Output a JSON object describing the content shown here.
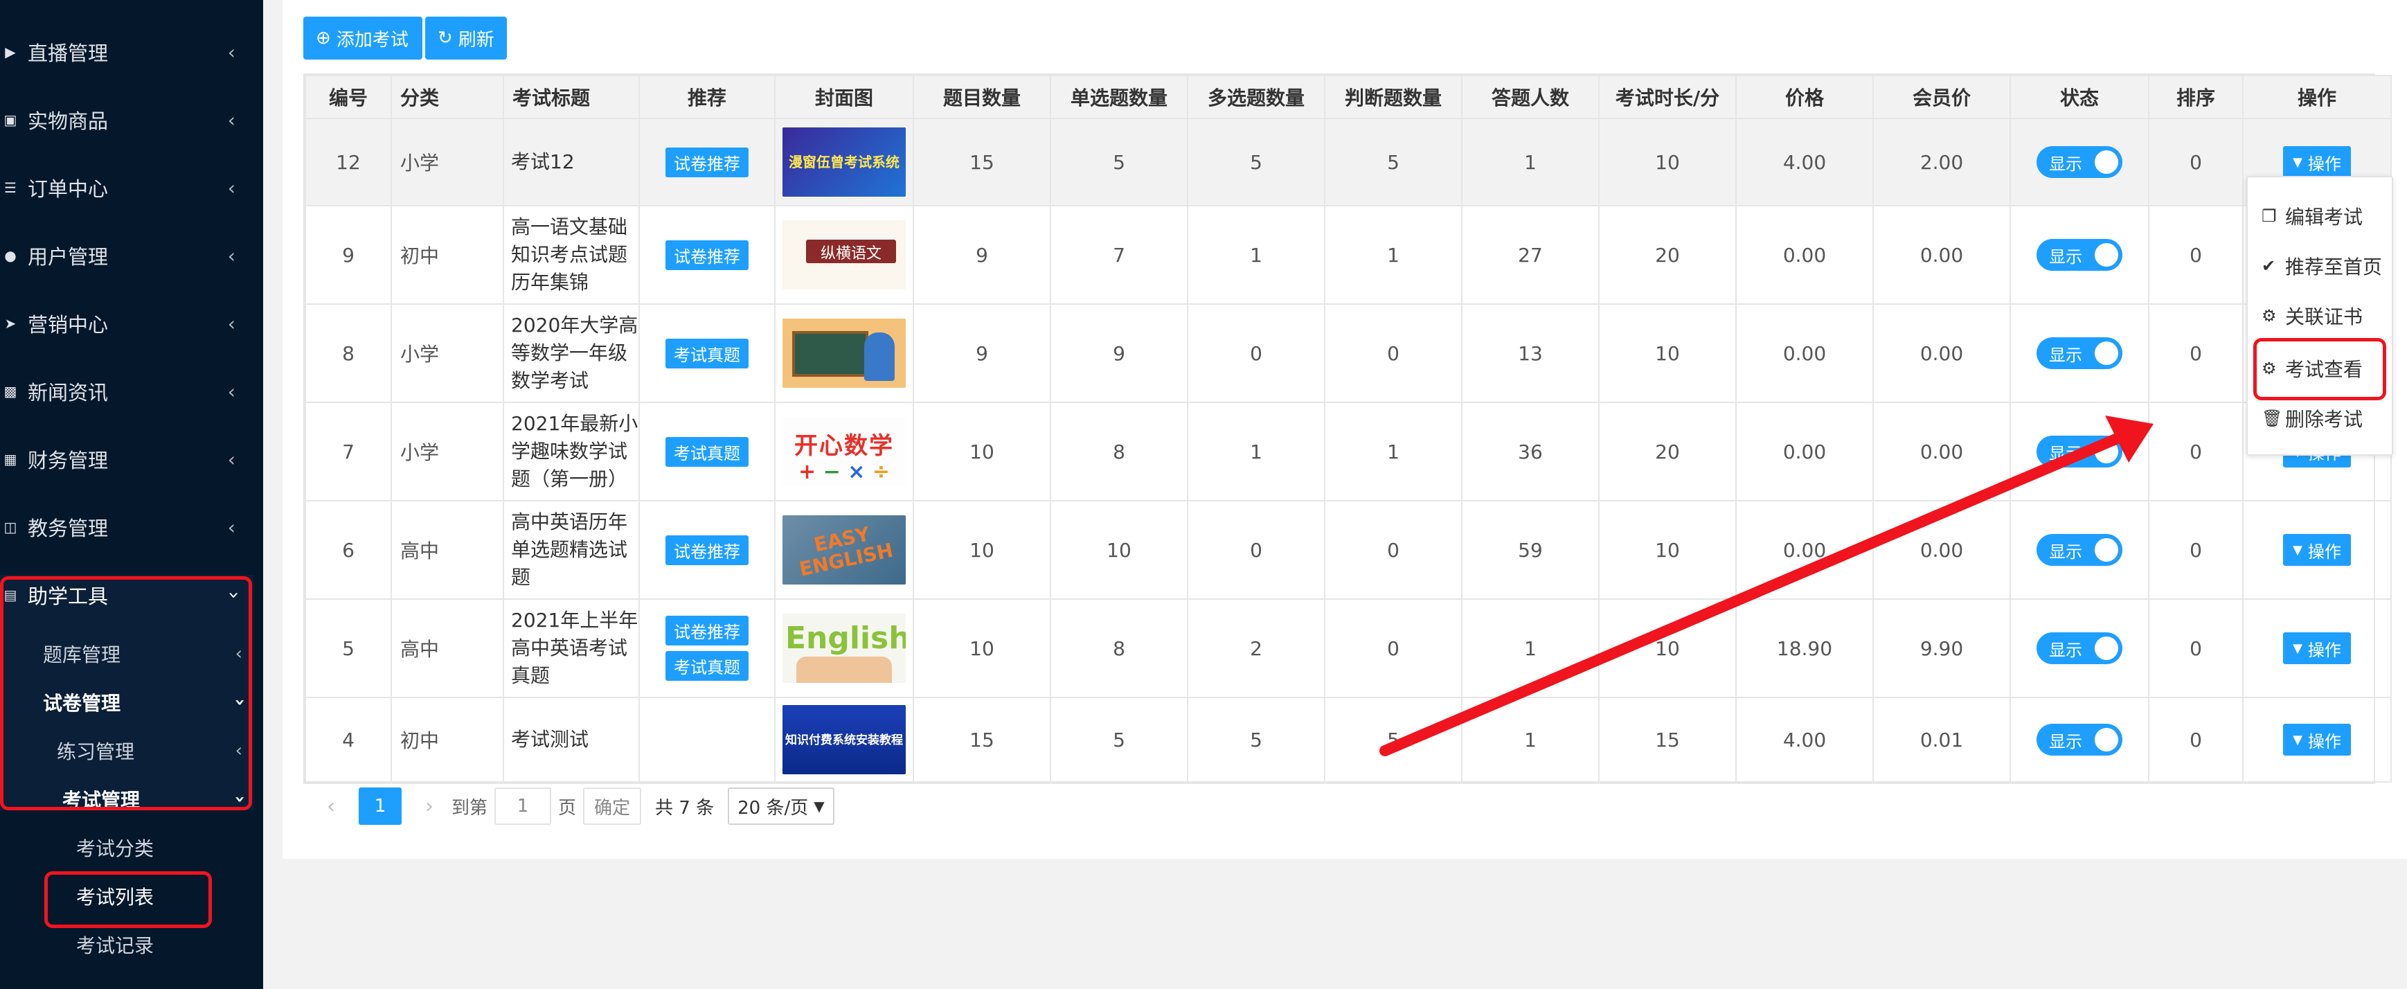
{
  "sidebar": {
    "items": [
      {
        "label": "直播管理",
        "icon": "video-icon"
      },
      {
        "label": "实物商品",
        "icon": "cart-icon"
      },
      {
        "label": "订单中心",
        "icon": "list-icon"
      },
      {
        "label": "用户管理",
        "icon": "user-icon"
      },
      {
        "label": "营销中心",
        "icon": "send-icon"
      },
      {
        "label": "新闻资讯",
        "icon": "image-icon"
      },
      {
        "label": "财务管理",
        "icon": "chart-icon"
      },
      {
        "label": "教务管理",
        "icon": "book-icon"
      }
    ],
    "active_group": "助学工具",
    "sub": {
      "question_bank": "题库管理",
      "paper_manage": "试卷管理",
      "practice_manage": "练习管理",
      "exam_manage": "考试管理",
      "exam_category": "考试分类",
      "exam_list": "考试列表",
      "exam_record": "考试记录"
    }
  },
  "toolbar": {
    "add_label": "添加考试",
    "refresh_label": "刷新"
  },
  "table": {
    "headers": [
      "编号",
      "分类",
      "考试标题",
      "推荐",
      "封面图",
      "题目数量",
      "单选题数量",
      "多选题数量",
      "判断题数量",
      "答题人数",
      "考试时长/分",
      "价格",
      "会员价",
      "状态",
      "排序",
      "操作"
    ],
    "rows": [
      {
        "id": "12",
        "category": "小学",
        "title": "考试12",
        "tags": [
          "试卷推荐"
        ],
        "cover_text": "漫窗伍曾考试系统",
        "q": "15",
        "single": "5",
        "multi": "5",
        "judge": "5",
        "people": "1",
        "duration": "10",
        "price": "4.00",
        "vip": "2.00",
        "status": "显示",
        "sort": "0",
        "op": "操作"
      },
      {
        "id": "9",
        "category": "初中",
        "title": "高一语文基础知识考点试题历年集锦",
        "tags": [
          "试卷推荐"
        ],
        "cover_text": "纵横语文",
        "q": "9",
        "single": "7",
        "multi": "1",
        "judge": "1",
        "people": "27",
        "duration": "20",
        "price": "0.00",
        "vip": "0.00",
        "status": "显示",
        "sort": "0",
        "op": "操作"
      },
      {
        "id": "8",
        "category": "小学",
        "title": "2020年大学高等数学一年级数学考试",
        "tags": [
          "考试真题"
        ],
        "cover_text": "",
        "q": "9",
        "single": "9",
        "multi": "0",
        "judge": "0",
        "people": "13",
        "duration": "10",
        "price": "0.00",
        "vip": "0.00",
        "status": "显示",
        "sort": "0",
        "op": "操作"
      },
      {
        "id": "7",
        "category": "小学",
        "title": "2021年最新小学趣味数学试题（第一册）",
        "tags": [
          "考试真题"
        ],
        "cover_text": "开心数学",
        "q": "10",
        "single": "8",
        "multi": "1",
        "judge": "1",
        "people": "36",
        "duration": "20",
        "price": "0.00",
        "vip": "0.00",
        "status": "显示",
        "sort": "0",
        "op": "操作"
      },
      {
        "id": "6",
        "category": "高中",
        "title": "高中英语历年单选题精选试题",
        "tags": [
          "试卷推荐"
        ],
        "cover_text": "EASY ENGLISH",
        "q": "10",
        "single": "10",
        "multi": "0",
        "judge": "0",
        "people": "59",
        "duration": "10",
        "price": "0.00",
        "vip": "0.00",
        "status": "显示",
        "sort": "0",
        "op": "操作"
      },
      {
        "id": "5",
        "category": "高中",
        "title": "2021年上半年高中英语考试真题",
        "tags": [
          "试卷推荐",
          "考试真题"
        ],
        "cover_text": "English",
        "q": "10",
        "single": "8",
        "multi": "2",
        "judge": "0",
        "people": "1",
        "duration": "10",
        "price": "18.90",
        "vip": "9.90",
        "status": "显示",
        "sort": "0",
        "op": "操作"
      },
      {
        "id": "4",
        "category": "初中",
        "title": "考试测试",
        "tags": [],
        "cover_text": "知识付费系统安装教程",
        "q": "15",
        "single": "5",
        "multi": "5",
        "judge": "5",
        "people": "1",
        "duration": "15",
        "price": "4.00",
        "vip": "0.01",
        "status": "显示",
        "sort": "0",
        "op": "操作"
      }
    ]
  },
  "pager": {
    "current": "1",
    "goto_label": "到第",
    "page_input": "1",
    "page_unit": "页",
    "confirm": "确定",
    "total": "共 7 条",
    "per_page": "20 条/页"
  },
  "menu": {
    "items": [
      {
        "label": "编辑考试",
        "icon": "copy-icon"
      },
      {
        "label": "推荐至首页",
        "icon": "check-circle-icon"
      },
      {
        "label": "关联证书",
        "icon": "gear-icon"
      },
      {
        "label": "考试查看",
        "icon": "gear-icon"
      },
      {
        "label": "删除考试",
        "icon": "trash-icon"
      }
    ]
  },
  "colors": {
    "sidebar_bg": "#05172b",
    "accent": "#1e9fff",
    "highlight_red": "#f0141e"
  }
}
